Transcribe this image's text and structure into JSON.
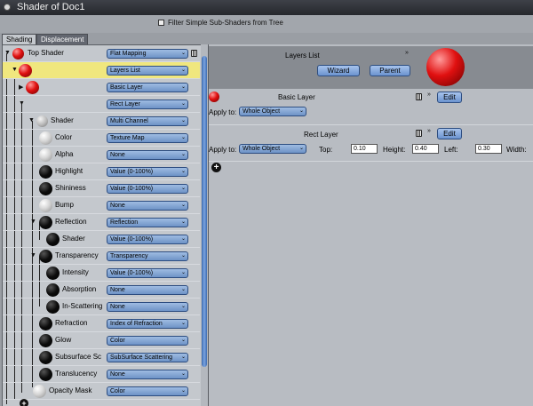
{
  "window": {
    "title": "Shader of Doc1"
  },
  "filter": {
    "label": "Filter Simple Sub-Shaders from Tree",
    "checked": false
  },
  "tabs": [
    {
      "label": "Shading",
      "active": true
    },
    {
      "label": "Displacement",
      "active": false
    }
  ],
  "tree": [
    {
      "label": "Top Shader",
      "value": "Flat Mapping",
      "ball": "red"
    },
    {
      "label": "",
      "value": "Layers List",
      "ball": "red",
      "selected": true
    },
    {
      "label": "",
      "value": "Basic Layer",
      "ball": "red"
    },
    {
      "label": "",
      "value": "Rect Layer",
      "ball": ""
    },
    {
      "label": "Shader",
      "value": "Multi Channel",
      "ball": "gray"
    },
    {
      "label": "Color",
      "value": "Texture Map",
      "ball": "white"
    },
    {
      "label": "Alpha",
      "value": "None",
      "ball": "white"
    },
    {
      "label": "Highlight",
      "value": "Value (0-100%)",
      "ball": "black"
    },
    {
      "label": "Shininess",
      "value": "Value (0-100%)",
      "ball": "black"
    },
    {
      "label": "Bump",
      "value": "None",
      "ball": "white"
    },
    {
      "label": "Reflection",
      "value": "Reflection",
      "ball": "black"
    },
    {
      "label": "Shader",
      "value": "Value (0-100%)",
      "ball": "black"
    },
    {
      "label": "Transparency",
      "value": "Transparency",
      "ball": "black"
    },
    {
      "label": "Intensity",
      "value": "Value (0-100%)",
      "ball": "black"
    },
    {
      "label": "Absorption",
      "value": "None",
      "ball": "black"
    },
    {
      "label": "In-Scattering",
      "value": "None",
      "ball": "black"
    },
    {
      "label": "Refraction",
      "value": "Index of Refraction",
      "ball": "black"
    },
    {
      "label": "Glow",
      "value": "Color",
      "ball": "black"
    },
    {
      "label": "Subsurface Sc",
      "value": "SubSurface Scattering",
      "ball": "black"
    },
    {
      "label": "Translucency",
      "value": "None",
      "ball": "black"
    },
    {
      "label": "Opacity Mask",
      "value": "Color",
      "ball": "white"
    }
  ],
  "right": {
    "header": {
      "title": "Layers List",
      "wizard": "Wizard",
      "parent": "Parent"
    },
    "basic": {
      "title": "Basic Layer",
      "edit": "Edit",
      "apply_label": "Apply to:",
      "apply_value": "Whole Object"
    },
    "rect": {
      "title": "Rect Layer",
      "edit": "Edit",
      "apply_label": "Apply to:",
      "apply_value": "Whole Object",
      "top_label": "Top:",
      "top": "0.10",
      "height_label": "Height:",
      "height": "0.40",
      "left_label": "Left:",
      "left": "0.30",
      "width_label": "Width:"
    }
  }
}
